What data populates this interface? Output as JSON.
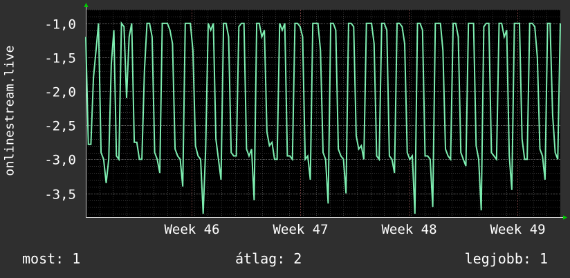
{
  "colors": {
    "background": "#2f2f2f",
    "plot_background": "#000000",
    "grid_major": "#5a5a5a",
    "grid_minor": "#3a3a3a",
    "series": "#7dedb0",
    "arrow": "#00cc00",
    "text": "#ffffff"
  },
  "legend": {
    "current": "most: 1",
    "average": "átlag: 2",
    "best": "legjobb: 1"
  },
  "chart_data": {
    "type": "line",
    "ylabel": "onlinestream.live",
    "xlabel": "",
    "ylim": [
      -3.85,
      -0.8
    ],
    "yticks": [
      -1.0,
      -1.5,
      -2.0,
      -2.5,
      -3.0,
      -3.5
    ],
    "ytick_labels": [
      "-1,0",
      "-1,5",
      "-2,0",
      "-2,5",
      "-3,0",
      "-3,5"
    ],
    "xticks": [
      "Week 46",
      "Week 47",
      "Week 48",
      "Week 49"
    ],
    "grid": true,
    "series": [
      {
        "values": [
          -1.2,
          -2.78,
          -2.78,
          -1.8,
          -1.4,
          -1.0,
          -2.9,
          -3.0,
          -3.35,
          -3.0,
          -1.6,
          -1.1,
          -2.95,
          -3.0,
          -1.0,
          -1.05,
          -2.1,
          -1.2,
          -1.0,
          -2.75,
          -2.75,
          -3.0,
          -3.0,
          -1.7,
          -1.0,
          -1.0,
          -1.2,
          -2.9,
          -3.0,
          -3.2,
          -1.0,
          -1.0,
          -1.0,
          -1.1,
          -1.3,
          -2.85,
          -2.95,
          -3.0,
          -3.4,
          -1.0,
          -1.0,
          -1.0,
          -1.4,
          -2.8,
          -2.95,
          -3.0,
          -3.8,
          -2.85,
          -1.0,
          -1.1,
          -1.0,
          -2.7,
          -3.0,
          -3.3,
          -1.0,
          -1.0,
          -1.2,
          -2.9,
          -2.95,
          -2.95,
          -1.05,
          -1.0,
          -1.0,
          -2.85,
          -2.95,
          -2.85,
          -3.6,
          -1.0,
          -1.0,
          -1.2,
          -1.1,
          -2.6,
          -2.8,
          -2.75,
          -3.0,
          -3.0,
          -1.0,
          -1.1,
          -1.0,
          -2.95,
          -2.95,
          -3.0,
          -1.0,
          -1.0,
          -1.05,
          -1.2,
          -3.0,
          -2.95,
          -3.3,
          -1.0,
          -1.0,
          -1.0,
          -1.4,
          -2.9,
          -3.0,
          -3.65,
          -1.0,
          -1.0,
          -1.1,
          -2.85,
          -2.95,
          -3.0,
          -3.5,
          -1.0,
          -1.0,
          -1.05,
          -2.65,
          -2.85,
          -2.8,
          -3.0,
          -1.0,
          -1.0,
          -1.0,
          -1.3,
          -2.95,
          -3.0,
          -1.0,
          -1.0,
          -1.1,
          -2.95,
          -3.0,
          -3.2,
          -1.0,
          -1.0,
          -1.05,
          -1.3,
          -2.9,
          -3.0,
          -2.95,
          -3.8,
          -1.0,
          -1.0,
          -1.1,
          -2.95,
          -2.95,
          -3.0,
          -3.7,
          -1.0,
          -1.0,
          -1.0,
          -1.4,
          -2.85,
          -2.95,
          -3.0,
          -1.0,
          -1.0,
          -1.2,
          -2.9,
          -3.0,
          -3.1,
          -1.0,
          -1.0,
          -1.0,
          -2.8,
          -3.0,
          -3.75,
          -1.05,
          -1.0,
          -1.0,
          -2.9,
          -2.95,
          -3.0,
          -1.0,
          -1.0,
          -1.2,
          -1.1,
          -2.95,
          -3.45,
          -1.0,
          -1.0,
          -1.0,
          -2.7,
          -3.0,
          -3.0,
          -1.0,
          -1.0,
          -1.05,
          -1.5,
          -2.85,
          -2.95,
          -3.3,
          -1.0,
          -1.0,
          -2.35,
          -2.9,
          -3.0,
          -1.0
        ]
      }
    ]
  }
}
